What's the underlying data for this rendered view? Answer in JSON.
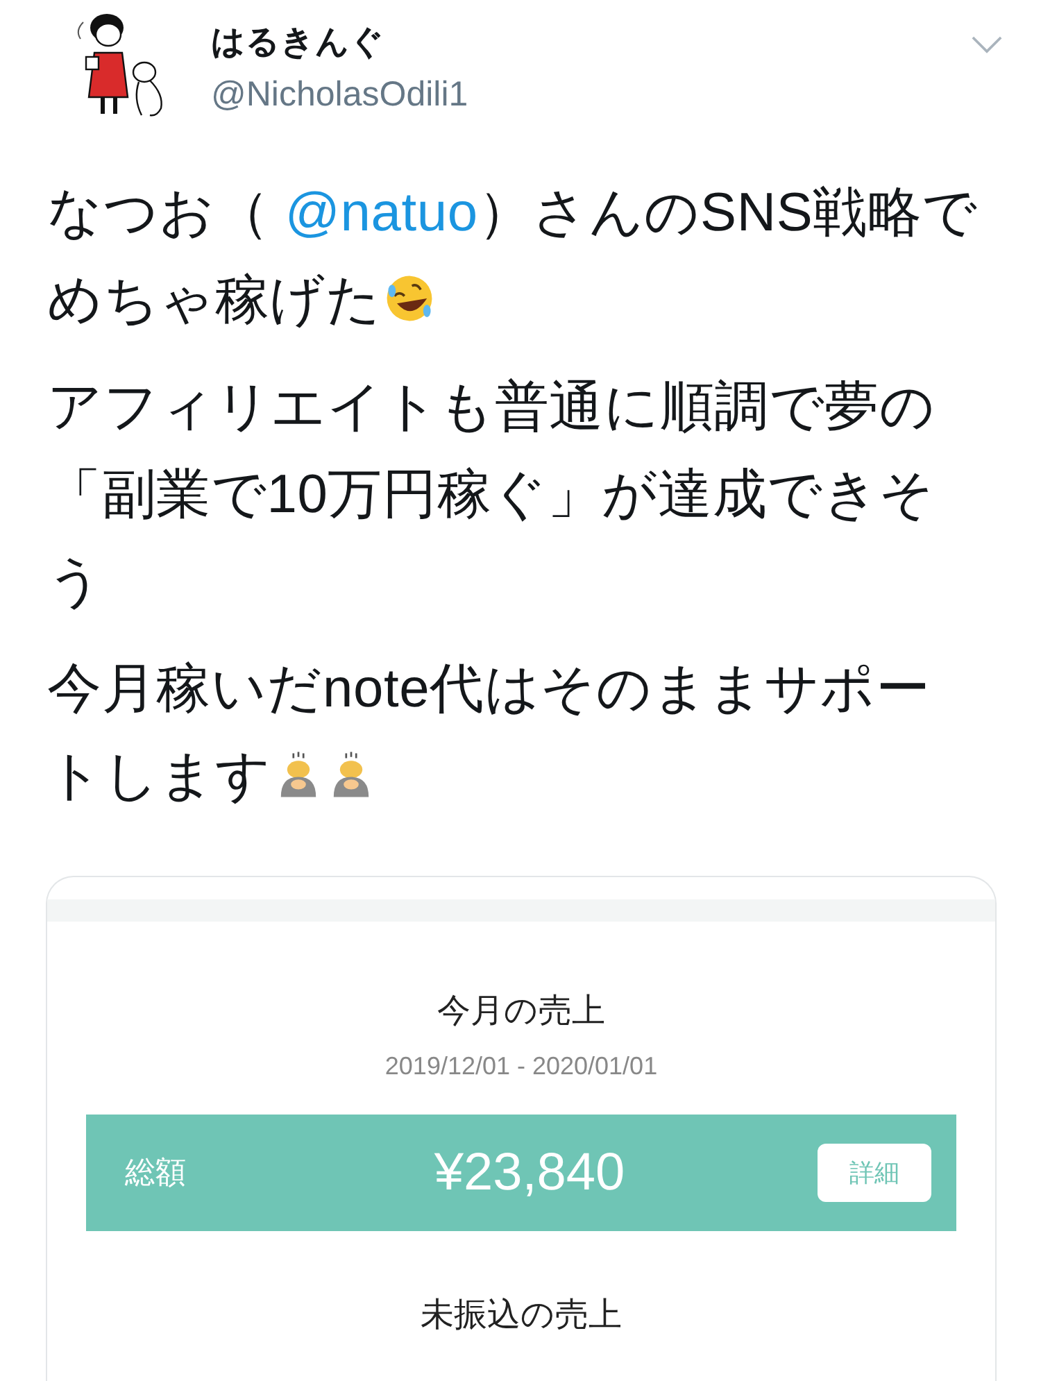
{
  "author": {
    "name": "はるきんぐ",
    "handle": "@NicholasOdili1"
  },
  "paragraphs": [
    [
      {
        "kind": "text",
        "text": "なつお（ "
      },
      {
        "kind": "mention",
        "text": "@natuo"
      },
      {
        "kind": "text",
        "text": "）さんのSNS戦略でめちゃ稼げた"
      },
      {
        "kind": "laughemoji"
      }
    ],
    [
      {
        "kind": "text",
        "text": "アフィリエイトも普通に順調で夢の「副業で10万円稼ぐ」が達成できそう"
      }
    ],
    [
      {
        "kind": "text",
        "text": "今月稼いだnote代はそのままサポートします"
      },
      {
        "kind": "bowemoji"
      },
      {
        "kind": "bowemoji"
      }
    ]
  ],
  "card": {
    "title": "今月の売上",
    "period": "2019/12/01 - 2020/01/01",
    "total_label": "総額",
    "total": "¥23,840",
    "detail_button": "詳細",
    "next_title": "未振込の売上"
  }
}
